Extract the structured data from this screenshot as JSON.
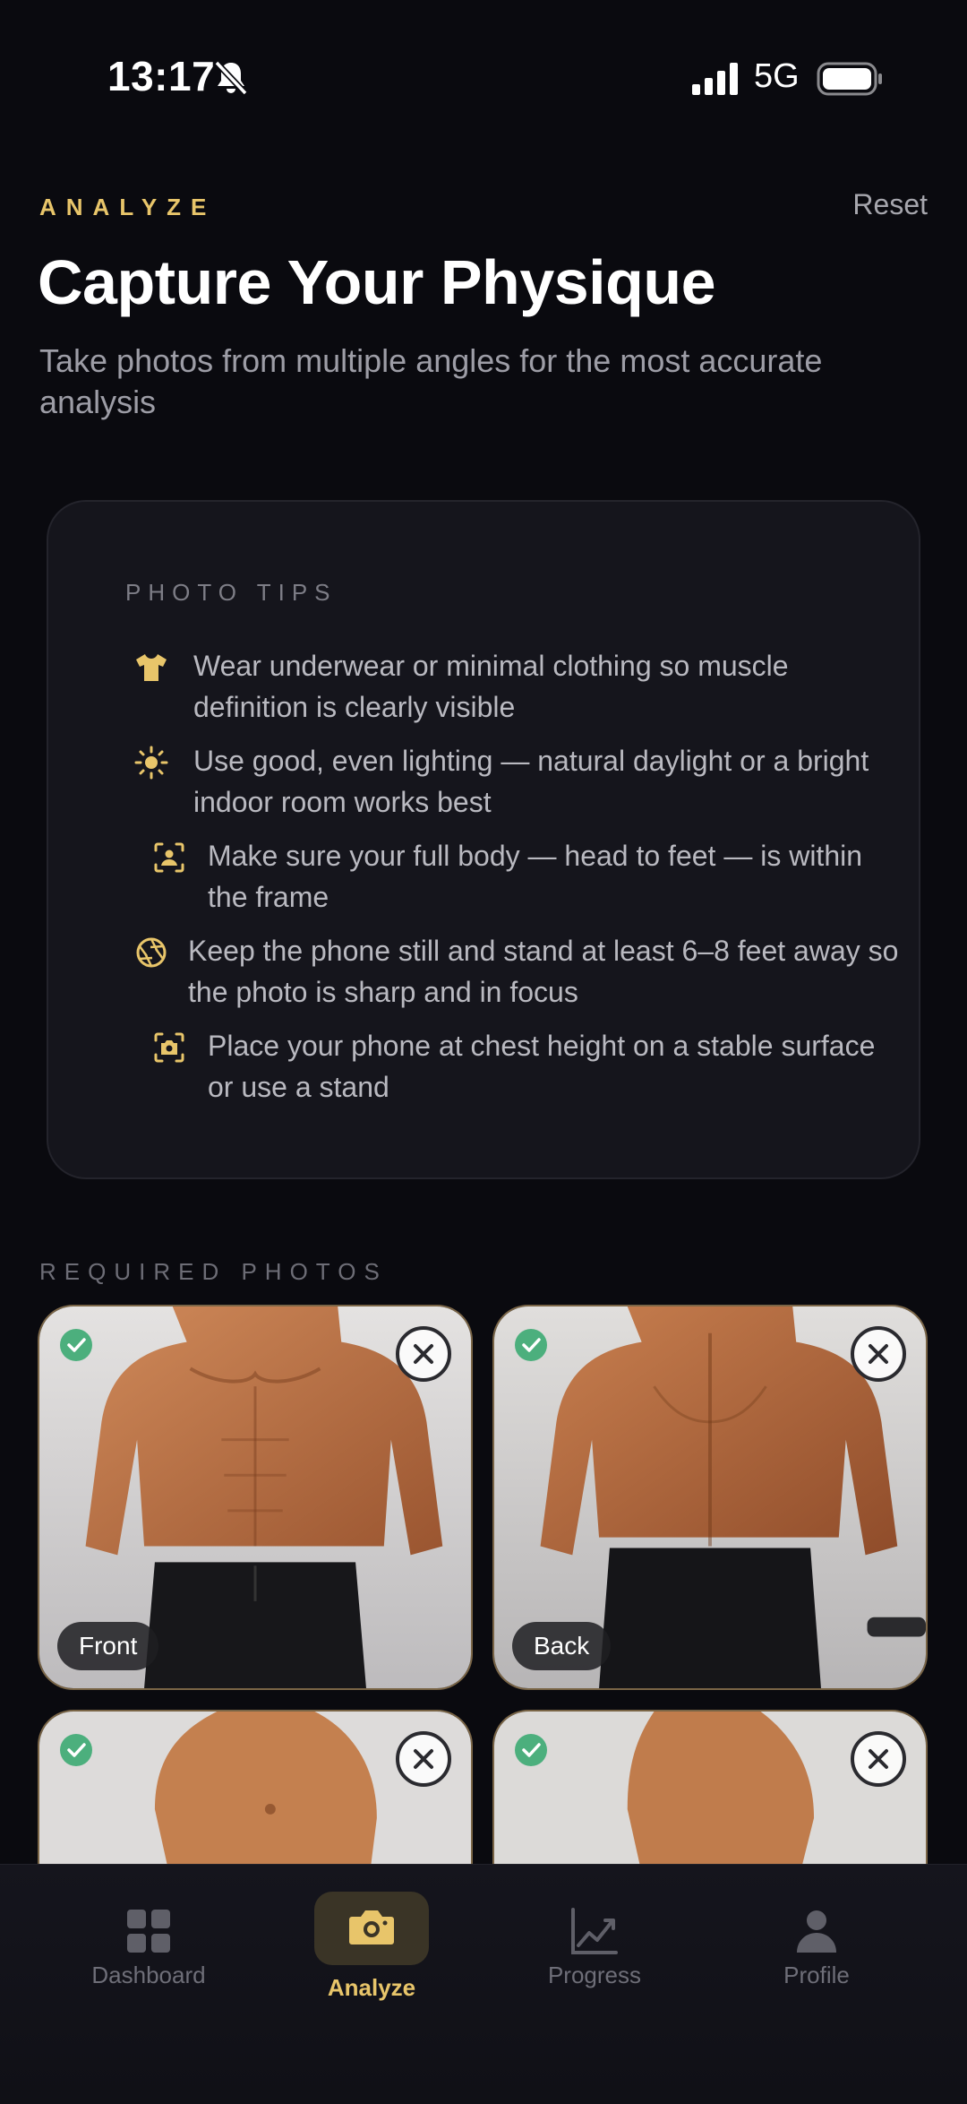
{
  "status_bar": {
    "time": "13:17",
    "network": "5G"
  },
  "header": {
    "eyebrow": "ANALYZE",
    "reset_label": "Reset",
    "title": "Capture Your Physique",
    "subtitle": "Take photos from multiple angles for the most accurate analysis"
  },
  "tips": {
    "heading": "PHOTO TIPS",
    "items": [
      {
        "icon": "tshirt-icon",
        "text": "Wear underwear or minimal clothing so muscle definition is clearly visible"
      },
      {
        "icon": "sun-icon",
        "text": "Use good, even lighting — natural daylight or a bright indoor room works best"
      },
      {
        "icon": "person-frame-icon",
        "text": "Make sure your full body — head to feet — is within the frame"
      },
      {
        "icon": "aperture-icon",
        "text": "Keep the phone still and stand at least 6–8 feet away so the photo is sharp and in focus"
      },
      {
        "icon": "camera-frame-icon",
        "text": "Place your phone at chest height on a stable surface or use a stand"
      }
    ]
  },
  "photos": {
    "heading": "REQUIRED PHOTOS",
    "items": [
      {
        "label": "Front",
        "captured": true
      },
      {
        "label": "Back",
        "captured": true
      },
      {
        "label": "",
        "captured": true
      },
      {
        "label": "",
        "captured": true
      }
    ]
  },
  "tab_bar": {
    "tabs": [
      {
        "label": "Dashboard",
        "icon": "grid-icon",
        "active": false
      },
      {
        "label": "Analyze",
        "icon": "camera-icon",
        "active": true
      },
      {
        "label": "Progress",
        "icon": "chart-icon",
        "active": false
      },
      {
        "label": "Profile",
        "icon": "person-icon",
        "active": false
      }
    ]
  },
  "colors": {
    "accent": "#e8c56a",
    "background": "#0a0a0f",
    "card": "#15151c",
    "success": "#4caf7d"
  }
}
